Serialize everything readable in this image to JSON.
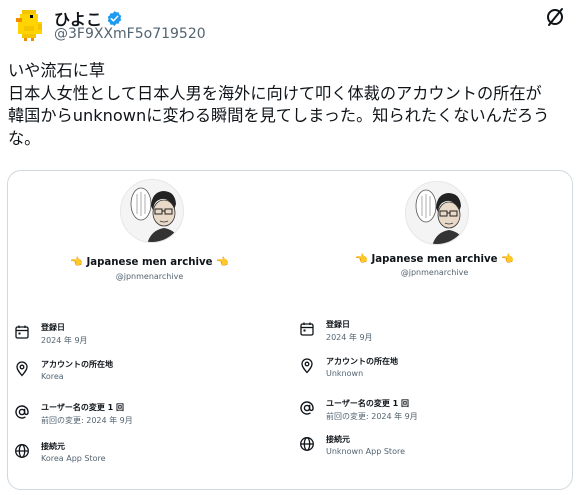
{
  "tweet": {
    "display_name": "ひよこ",
    "handle": "@3F9XXmF5o719520",
    "text_lines": [
      "いや流石に草",
      "日本人女性として日本人男を海外に向けて叩く体裁のアカウントの所在が",
      "韓国からunknownに変わる瞬間を見てしまった。知られたくないんだろう",
      "な。"
    ]
  },
  "icons": {
    "avatar": "yellow-chick-icon",
    "verified": "verified-badge-icon",
    "grok": "grok-icon",
    "registered": "calendar-icon",
    "location": "location-pin-icon",
    "username": "at-sign-icon",
    "connection": "globe-icon"
  },
  "colors": {
    "verified_blue": "#1d9bf0",
    "text_primary": "#0f1419",
    "text_secondary": "#536471",
    "border": "#cfd9de"
  },
  "profiles": [
    {
      "name": "Japanese men archive",
      "handle": "@jpnmenarchive",
      "name_emoji": "👈",
      "rows": [
        {
          "label": "登録日",
          "value": "2024 年 9月"
        },
        {
          "label": "アカウントの所在地",
          "value": "Korea"
        },
        {
          "label": "ユーザー名の変更 1 回",
          "value": "前回の変更: 2024 年 9月"
        },
        {
          "label": "接続元",
          "value": "Korea App Store"
        }
      ]
    },
    {
      "name": "Japanese men archive",
      "handle": "@jpnmenarchive",
      "name_emoji": "👈",
      "rows": [
        {
          "label": "登録日",
          "value": "2024 年 9月"
        },
        {
          "label": "アカウントの所在地",
          "value": "Unknown"
        },
        {
          "label": "ユーザー名の変更 1 回",
          "value": "前回の変更: 2024 年 9月"
        },
        {
          "label": "接続元",
          "value": "Unknown App Store"
        }
      ]
    }
  ]
}
